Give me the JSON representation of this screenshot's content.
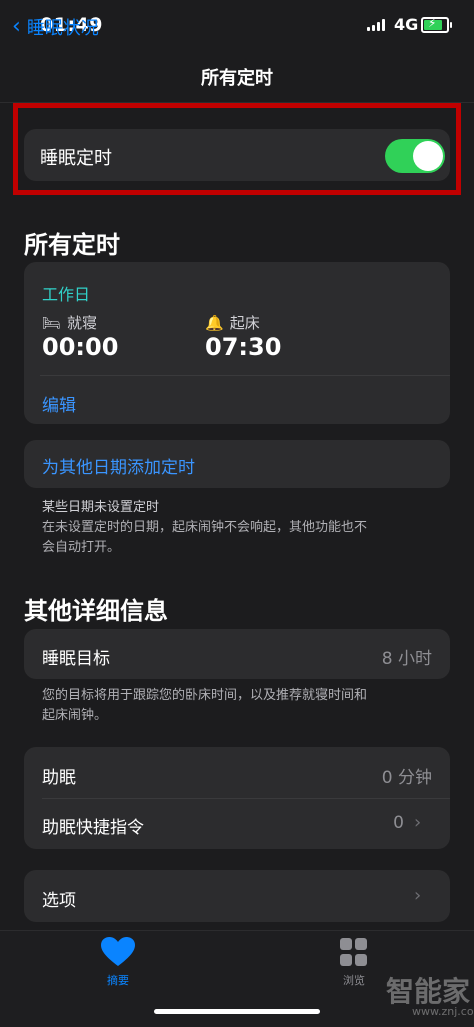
{
  "status": {
    "time": "01:49",
    "network": "4G"
  },
  "nav": {
    "back_label": "睡眠状况",
    "title": "所有定时"
  },
  "sleep_schedule": {
    "label": "睡眠定时",
    "enabled": true
  },
  "all_schedules": {
    "heading": "所有定时",
    "days_label": "工作日",
    "bedtime_label": "就寝",
    "bedtime_value": "00:00",
    "wake_label": "起床",
    "wake_value": "07:30",
    "edit_label": "编辑",
    "add_label": "为其他日期添加定时",
    "note_line1": "某些日期未设置定时",
    "note_line2": "在未设置定时的日期，起床闹钟不会响起，其他功能也不",
    "note_line3": "会自动打开。"
  },
  "details": {
    "heading": "其他详细信息",
    "goal_label": "睡眠目标",
    "goal_value": "8 小时",
    "goal_note_line1": "您的目标将用于跟踪您的卧床时间，以及推荐就寝时间和",
    "goal_note_line2": "起床闹钟。",
    "winddown_label": "助眠",
    "winddown_value": "0 分钟",
    "shortcuts_label": "助眠快捷指令",
    "shortcuts_value": "0",
    "options_label": "选项"
  },
  "tabbar": {
    "summary_label": "摘要",
    "browse_label": "浏览"
  },
  "watermark": {
    "brand": "智能家",
    "url": "www.znj.com"
  },
  "colors": {
    "accent": "#0a84ff",
    "toggle_on": "#30d158",
    "teal": "#31d2c9",
    "highlight_box": "#c00000"
  }
}
